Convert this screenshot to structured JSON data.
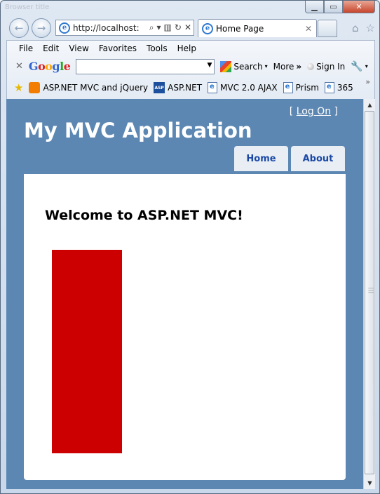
{
  "window": {
    "title": "Browser title",
    "minimize_icon": "minimize-icon",
    "maximize_icon": "maximize-icon",
    "close_icon": "close-icon"
  },
  "nav": {
    "address": "http://localhost:",
    "tab_title": "Home Page"
  },
  "menubar": {
    "items": [
      "File",
      "Edit",
      "View",
      "Favorites",
      "Tools",
      "Help"
    ]
  },
  "google_toolbar": {
    "search_label": "Search",
    "more_label": "More",
    "signin_label": "Sign In"
  },
  "favorites": {
    "items": [
      "ASP.NET MVC and jQuery",
      "ASP.NET",
      "MVC 2.0 AJAX",
      "Prism",
      "365"
    ]
  },
  "page": {
    "logon_open": "[",
    "logon_link": "Log On",
    "logon_close": "]",
    "app_title": "My MVC Application",
    "menu": [
      "Home",
      "About"
    ],
    "heading": "Welcome to ASP.NET MVC!",
    "box_color": "#cc0000",
    "header_color": "#5c87b2"
  }
}
